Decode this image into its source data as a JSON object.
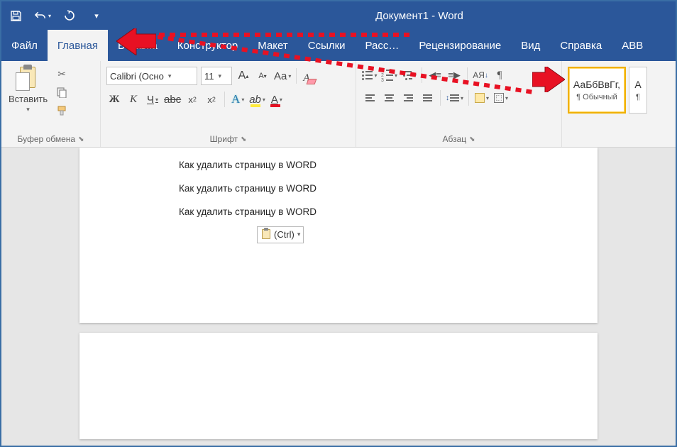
{
  "title": "Документ1  -  Word",
  "tabs": {
    "file": "Файл",
    "home": "Главная",
    "insert": "Вставка",
    "design": "Конструктор",
    "layout": "Макет",
    "references": "Ссылки",
    "mailings": "Расс…",
    "review": "Рецензирование",
    "view": "Вид",
    "help": "Справка",
    "abb": "ABB"
  },
  "clipboard": {
    "paste": "Вставить",
    "group": "Буфер обмена"
  },
  "font": {
    "name": "Calibri (Осно",
    "size": "11",
    "group": "Шрифт",
    "caseLabel": "Aa",
    "bigA": "A",
    "smallA": "A",
    "bold": "Ж",
    "italic": "К",
    "underline": "Ч",
    "strike": "abc",
    "sub": "x",
    "sup": "x",
    "fx": "A",
    "hilite": "ab",
    "colorA": "A"
  },
  "para": {
    "group": "Абзац",
    "sort": "А↓",
    "pilcrow": "¶"
  },
  "styles": {
    "tile1_preview": "АаБбВвГг,",
    "tile1_name": "¶ Обычный",
    "tile2_preview": "А",
    "tile2_name": "¶"
  },
  "doc": {
    "line1": "Как удалить страницу в WORD",
    "line2": "Как удалить страницу в WORD",
    "line3": "Как удалить страницу в WORD",
    "pasteopt": "(Ctrl)"
  }
}
